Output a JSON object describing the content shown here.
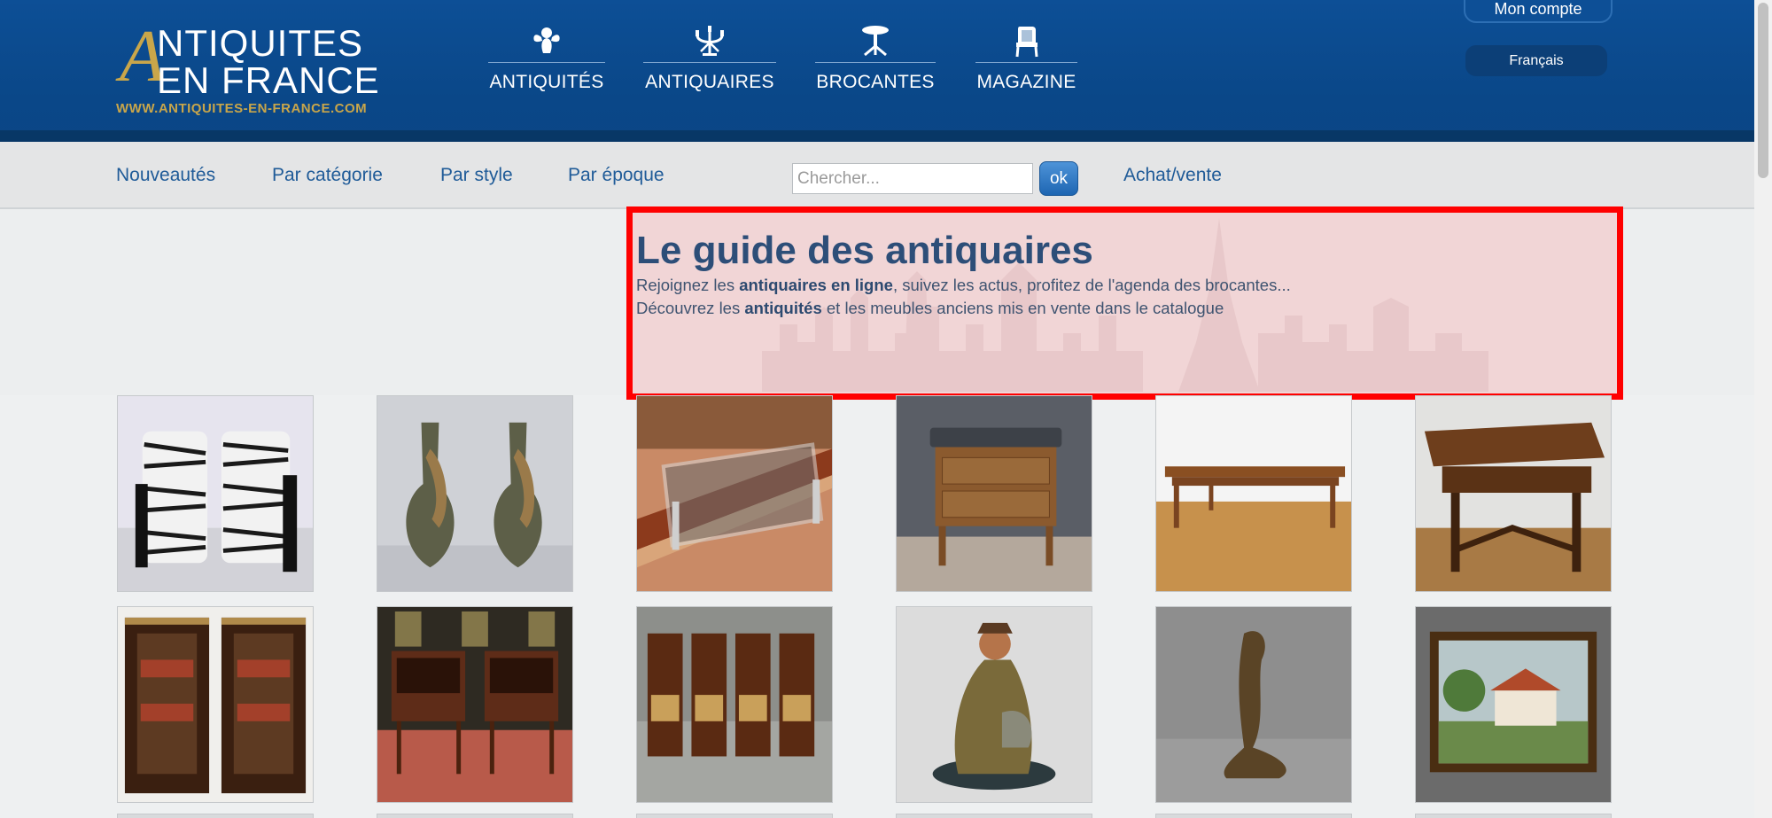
{
  "header": {
    "logo": {
      "big_letter": "A",
      "line1": "NTIQUITES",
      "line2": "EN FRANCE",
      "url": "WWW.ANTIQUITES-EN-FRANCE.COM"
    },
    "nav": [
      {
        "label": "ANTIQUITÉS",
        "icon": "cherub-icon"
      },
      {
        "label": "ANTIQUAIRES",
        "icon": "candelabra-icon"
      },
      {
        "label": "BROCANTES",
        "icon": "pedestal-table-icon"
      },
      {
        "label": "MAGAZINE",
        "icon": "armchair-icon"
      }
    ],
    "account_label": "Mon compte",
    "language_label": "Français"
  },
  "subnav": {
    "links": [
      "Nouveautés",
      "Par catégorie",
      "Par style",
      "Par époque"
    ],
    "search_placeholder": "Chercher...",
    "search_button": "ok",
    "buy_sell": "Achat/vente"
  },
  "hero": {
    "title": "Le guide des antiquaires",
    "line1_a": "Rejoignez les ",
    "line1_b": "antiquaires en ligne",
    "line1_c": ", suivez les actus, profitez de l'agenda des brocantes...",
    "line2_a": "Découvrez les ",
    "line2_b": "antiquités",
    "line2_c": " et les meubles anciens mis en vente dans le catalogue"
  },
  "products": [
    {
      "subject": "zebra armchairs"
    },
    {
      "subject": "bronze vases"
    },
    {
      "subject": "glass coffee table"
    },
    {
      "subject": "marble top commode"
    },
    {
      "subject": "farm table"
    },
    {
      "subject": "side table"
    },
    {
      "subject": "pair of bookcases"
    },
    {
      "subject": "pair of night stands"
    },
    {
      "subject": "four chairs"
    },
    {
      "subject": "fisherman statue"
    },
    {
      "subject": "bronze figurine"
    },
    {
      "subject": "framed painting"
    }
  ],
  "colors": {
    "header_blue": "#0d4f96",
    "gold": "#c9a64a",
    "link_blue": "#1f5b98",
    "highlight_red": "#ff0000"
  }
}
